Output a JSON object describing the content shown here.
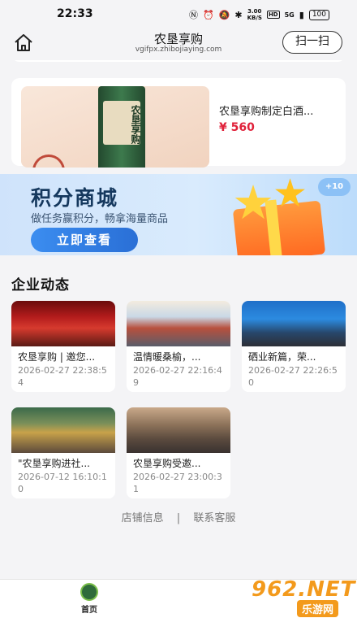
{
  "status_bar": {
    "time": "22:33",
    "net_speed_value": "3.00",
    "net_speed_unit": "KB/S",
    "hd": "HD",
    "signal": "5G",
    "battery": "100"
  },
  "nav": {
    "title": "农垦享购",
    "url": "vgifpx.zhibojiaying.com",
    "scan_label": "扫一扫"
  },
  "product": {
    "name": "农垦享购制定白酒...",
    "price": "¥ 560",
    "bottle_label": "农垦享购"
  },
  "banner": {
    "title": "积分商城",
    "subtitle": "做任务赢积分，畅拿海量商品",
    "button": "立即查看",
    "badge": "+10"
  },
  "news_section": {
    "title": "企业动态",
    "items": [
      {
        "title": "农垦享购 | 邀您...",
        "date": "2026-02-27 22:38:54"
      },
      {
        "title": "温情暖桑榆，...",
        "date": "2026-02-27 22:16:49"
      },
      {
        "title": "硒业新篇，荣...",
        "date": "2026-02-27 22:26:50"
      },
      {
        "title": "\"农垦享购进社...",
        "date": "2026-07-12 16:10:10"
      },
      {
        "title": "农垦享购受邀...",
        "date": "2026-02-27 23:00:31"
      }
    ]
  },
  "footer": {
    "store_info": "店铺信息",
    "separator": "|",
    "contact": "联系客服"
  },
  "tab_bar": {
    "home_label": "首页"
  },
  "watermark": {
    "main": "962.NET",
    "sub": "乐游网"
  }
}
